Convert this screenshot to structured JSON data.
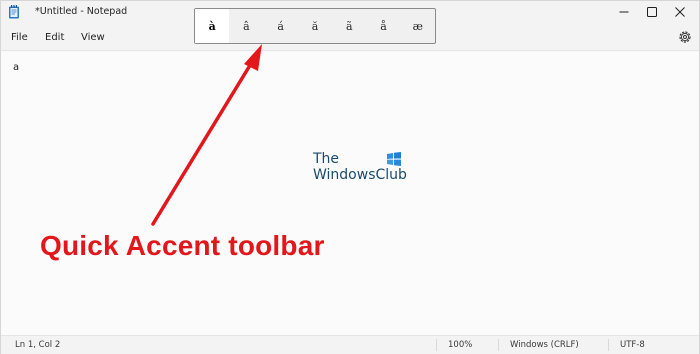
{
  "window": {
    "title": "*Untitled - Notepad",
    "icons": {
      "app": "notepad-icon",
      "minimize": "minimize-icon",
      "maximize": "maximize-icon",
      "close": "close-icon"
    }
  },
  "menu": {
    "file": "File",
    "edit": "Edit",
    "view": "View",
    "settings_icon": "gear-icon"
  },
  "editor": {
    "content": "a"
  },
  "accent_toolbar": {
    "keys": [
      "à",
      "â",
      "á",
      "ă",
      "ã",
      "å",
      "æ"
    ],
    "selected_index": 0
  },
  "watermark": {
    "line1": "The",
    "line2": "WindowsClub",
    "flag_colors": [
      "#1e90ff",
      "#4aa3df"
    ]
  },
  "annotation": {
    "label": "Quick Accent toolbar",
    "color": "#e3161b"
  },
  "statusbar": {
    "position": "Ln 1, Col 2",
    "zoom": "100%",
    "line_ending": "Windows (CRLF)",
    "encoding": "UTF-8"
  }
}
